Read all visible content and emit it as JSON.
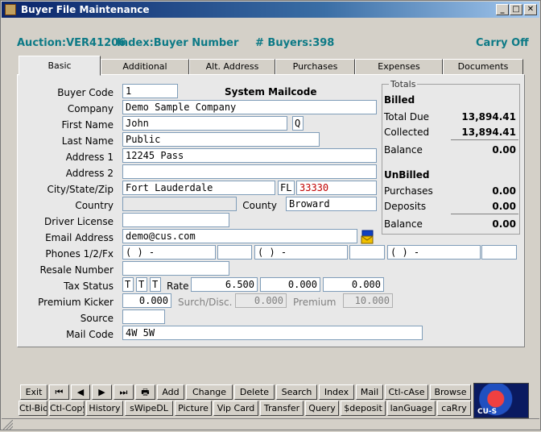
{
  "window": {
    "title": "Buyer File Maintenance"
  },
  "header": {
    "auction": "Auction:VER41206",
    "index": "Index:Buyer Number",
    "buyers": "# Buyers:398",
    "carry": "Carry Off"
  },
  "tabs": [
    "Basic",
    "Additional",
    "Alt. Address",
    "Purchases",
    "Expenses",
    "Documents"
  ],
  "form": {
    "buyer_code_label": "Buyer Code",
    "buyer_code": "1",
    "system_mailcode": "System Mailcode",
    "company_label": "Company",
    "company": "Demo Sample Company",
    "first_name_label": "First Name",
    "first_name": "John",
    "middle_initial": "Q",
    "last_name_label": "Last Name",
    "last_name": "Public",
    "address1_label": "Address 1",
    "address1": "12245 Pass",
    "address2_label": "Address 2",
    "address2": "",
    "csz_label": "City/State/Zip",
    "city": "Fort Lauderdale",
    "state": "FL",
    "zip": "33330",
    "country_label": "Country",
    "country": "",
    "county_label": "County",
    "county": "Broward",
    "driver_license_label": "Driver License",
    "driver_license": "",
    "email_label": "Email Address",
    "email": "demo@cus.com",
    "phones_label": "Phones 1/2/Fx",
    "phone_mask": "(   )    -",
    "resale_label": "Resale Number",
    "resale": "",
    "tax_status_label": "Tax Status",
    "tax1": "T",
    "tax2": "T",
    "tax3": "T",
    "rate_label": "Rate",
    "rate1": "6.500",
    "rate2": "0.000",
    "rate3": "0.000",
    "premium_kicker_label": "Premium Kicker",
    "premium_kicker": "0.000",
    "surch_label": "Surch/Disc.",
    "surch": "0.000",
    "premium_label": "Premium",
    "premium": "10.000",
    "source_label": "Source",
    "source": "",
    "mail_code_label": "Mail Code",
    "mail_code": "4W 5W"
  },
  "totals": {
    "caption": "Totals",
    "billed": "Billed",
    "total_due_label": "Total Due",
    "total_due": "13,894.41",
    "collected_label": "Collected",
    "collected": "13,894.41",
    "balance_label": "Balance",
    "balance": "0.00",
    "unbilled": "UnBilled",
    "purchases_label": "Purchases",
    "purchases": "0.00",
    "deposits_label": "Deposits",
    "deposits": "0.00",
    "balance2_label": "Balance",
    "balance2": "0.00"
  },
  "toolbar": {
    "row1": [
      "Exit",
      "⏮",
      "◀",
      "▶",
      "⏭",
      "🖶",
      "Add",
      "Change",
      "Delete",
      "Search",
      "Index",
      "Mail",
      "Ctl-cAse",
      "Browse"
    ],
    "row2": [
      "Ctl-Bid",
      "Ctl-Copy",
      "History",
      "sWipeDL",
      "Picture",
      "Vip Card",
      "Transfer",
      "Query",
      "$deposit",
      "lanGuage",
      "caRry"
    ]
  },
  "logo": {
    "text": "CU-S"
  }
}
